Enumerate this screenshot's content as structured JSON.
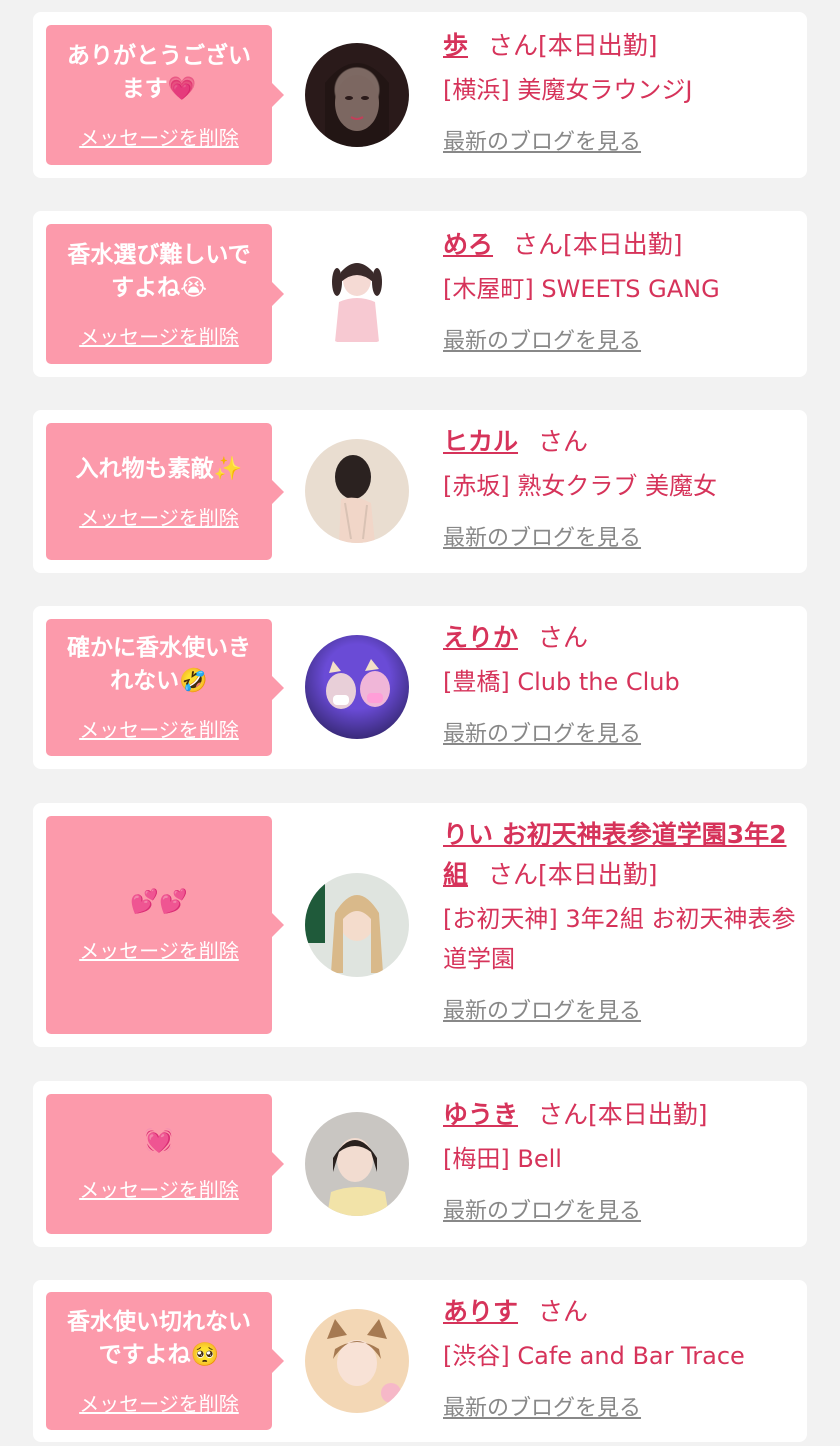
{
  "common": {
    "delete_label": "メッセージを削除",
    "blog_label": "最新のブログを見る"
  },
  "items": [
    {
      "message": "ありがとうございます💗",
      "name": "歩",
      "honorific": "さん",
      "status": "[本日出勤]",
      "shop": "[横浜] 美魔女ラウンジJ"
    },
    {
      "message": "香水選び難しいですよね😭",
      "name": "めろ",
      "honorific": "さん",
      "status": "[本日出勤]",
      "shop": "[木屋町] SWEETS GANG"
    },
    {
      "message": "入れ物も素敵✨",
      "name": "ヒカル",
      "honorific": "さん",
      "status": "",
      "shop": "[赤坂] 熟女クラブ 美魔女"
    },
    {
      "message": "確かに香水使いきれない🤣",
      "name": "えりか",
      "honorific": "さん",
      "status": "",
      "shop": "[豊橋] Club the Club"
    },
    {
      "message": "💕💕",
      "name": "りい お初天神表参道学園3年2組",
      "honorific": "さん",
      "status": "[本日出勤]",
      "shop": "[お初天神] 3年2組 お初天神表参道学園"
    },
    {
      "message": "💓",
      "name": "ゆうき",
      "honorific": "さん",
      "status": "[本日出勤]",
      "shop": "[梅田] Bell"
    },
    {
      "message": "香水使い切れないですよね🥺",
      "name": "ありす",
      "honorific": "さん",
      "status": "",
      "shop": "[渋谷] Cafe and Bar Trace"
    }
  ],
  "colors": {
    "accent": "#d6335a",
    "bubble": "#fc9aab",
    "muted": "#888888",
    "background": "#f2f2f2"
  }
}
